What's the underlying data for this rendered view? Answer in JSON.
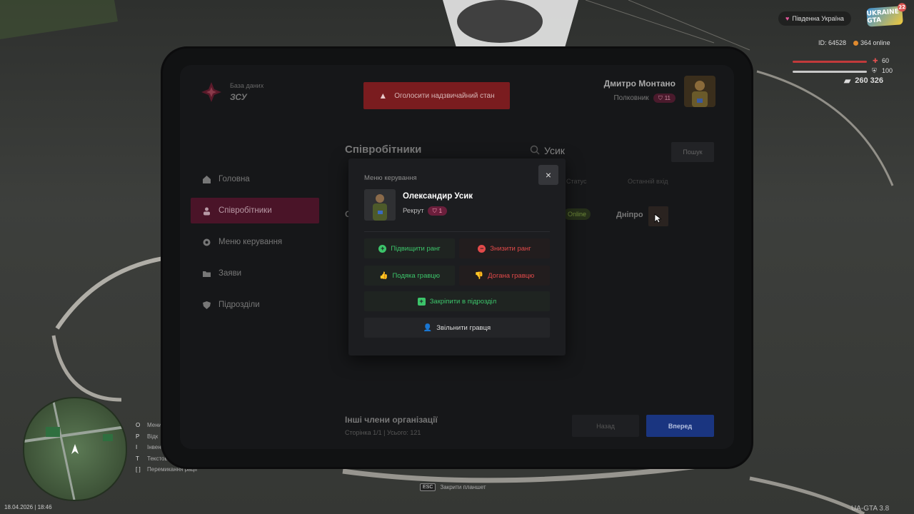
{
  "hud": {
    "server": "Південна Україна",
    "logo": "UKRAINE GTA",
    "logo_badge": "22",
    "id_text": "ID: 64528",
    "online": "364 online",
    "health": "60",
    "armor": "100",
    "money": "260 326",
    "date": "18.04.2026 | 18:46",
    "version": "UA-GTA 3.8",
    "esc_key": "ESC",
    "esc_text": "Закрити планшет",
    "keys": [
      {
        "key": "O",
        "label": "Мени"
      },
      {
        "key": "P",
        "label": "Відк"
      },
      {
        "key": "I",
        "label": "Інвент"
      },
      {
        "key": "T",
        "label": "Текстовий чат"
      },
      {
        "key": "[ ]",
        "label": "Перемикання рації"
      }
    ]
  },
  "brand": {
    "subtitle": "База даних",
    "title": "ЗСУ"
  },
  "emergency_button": "Оголосити надзвичайний стан",
  "user": {
    "name": "Дмитро Монтано",
    "rank": "Полковник",
    "rank_level": "11"
  },
  "nav": [
    {
      "label": "Головна",
      "icon": "home-icon"
    },
    {
      "label": "Співробітники",
      "icon": "users-icon"
    },
    {
      "label": "Меню керування",
      "icon": "gear-icon"
    },
    {
      "label": "Заяви",
      "icon": "folder-icon"
    },
    {
      "label": "Підрозділи",
      "icon": "shield-icon"
    }
  ],
  "employees": {
    "title": "Співробітники",
    "search_value": "Усик",
    "search_button": "Пошук",
    "columns": {
      "status": "Статус",
      "last_login": "Останній вхід"
    },
    "row": {
      "name_initial": "О",
      "status": "Online",
      "city": "Дніпро"
    },
    "footer_title": "Інші члени організації",
    "footer_sub": "Сторінка 1/1 | Усього: 121",
    "back": "Назад",
    "next": "Вперед"
  },
  "modal": {
    "caption": "Меню керування",
    "close": "×",
    "name": "Олександир Усик",
    "rank": "Рекрут",
    "rank_level": "1",
    "promote": "Підвищити ранг",
    "demote": "Знизити ранг",
    "thanks": "Подяка гравцю",
    "reprimand": "Догана гравцю",
    "assign": "Закріпити в підрозділ",
    "fire": "Звільнити гравця"
  },
  "colors": {
    "accent": "#4a1428",
    "primary": "#1a3580",
    "danger": "#7a1c1f",
    "success": "#3cc46a",
    "error": "#e24a4a"
  }
}
